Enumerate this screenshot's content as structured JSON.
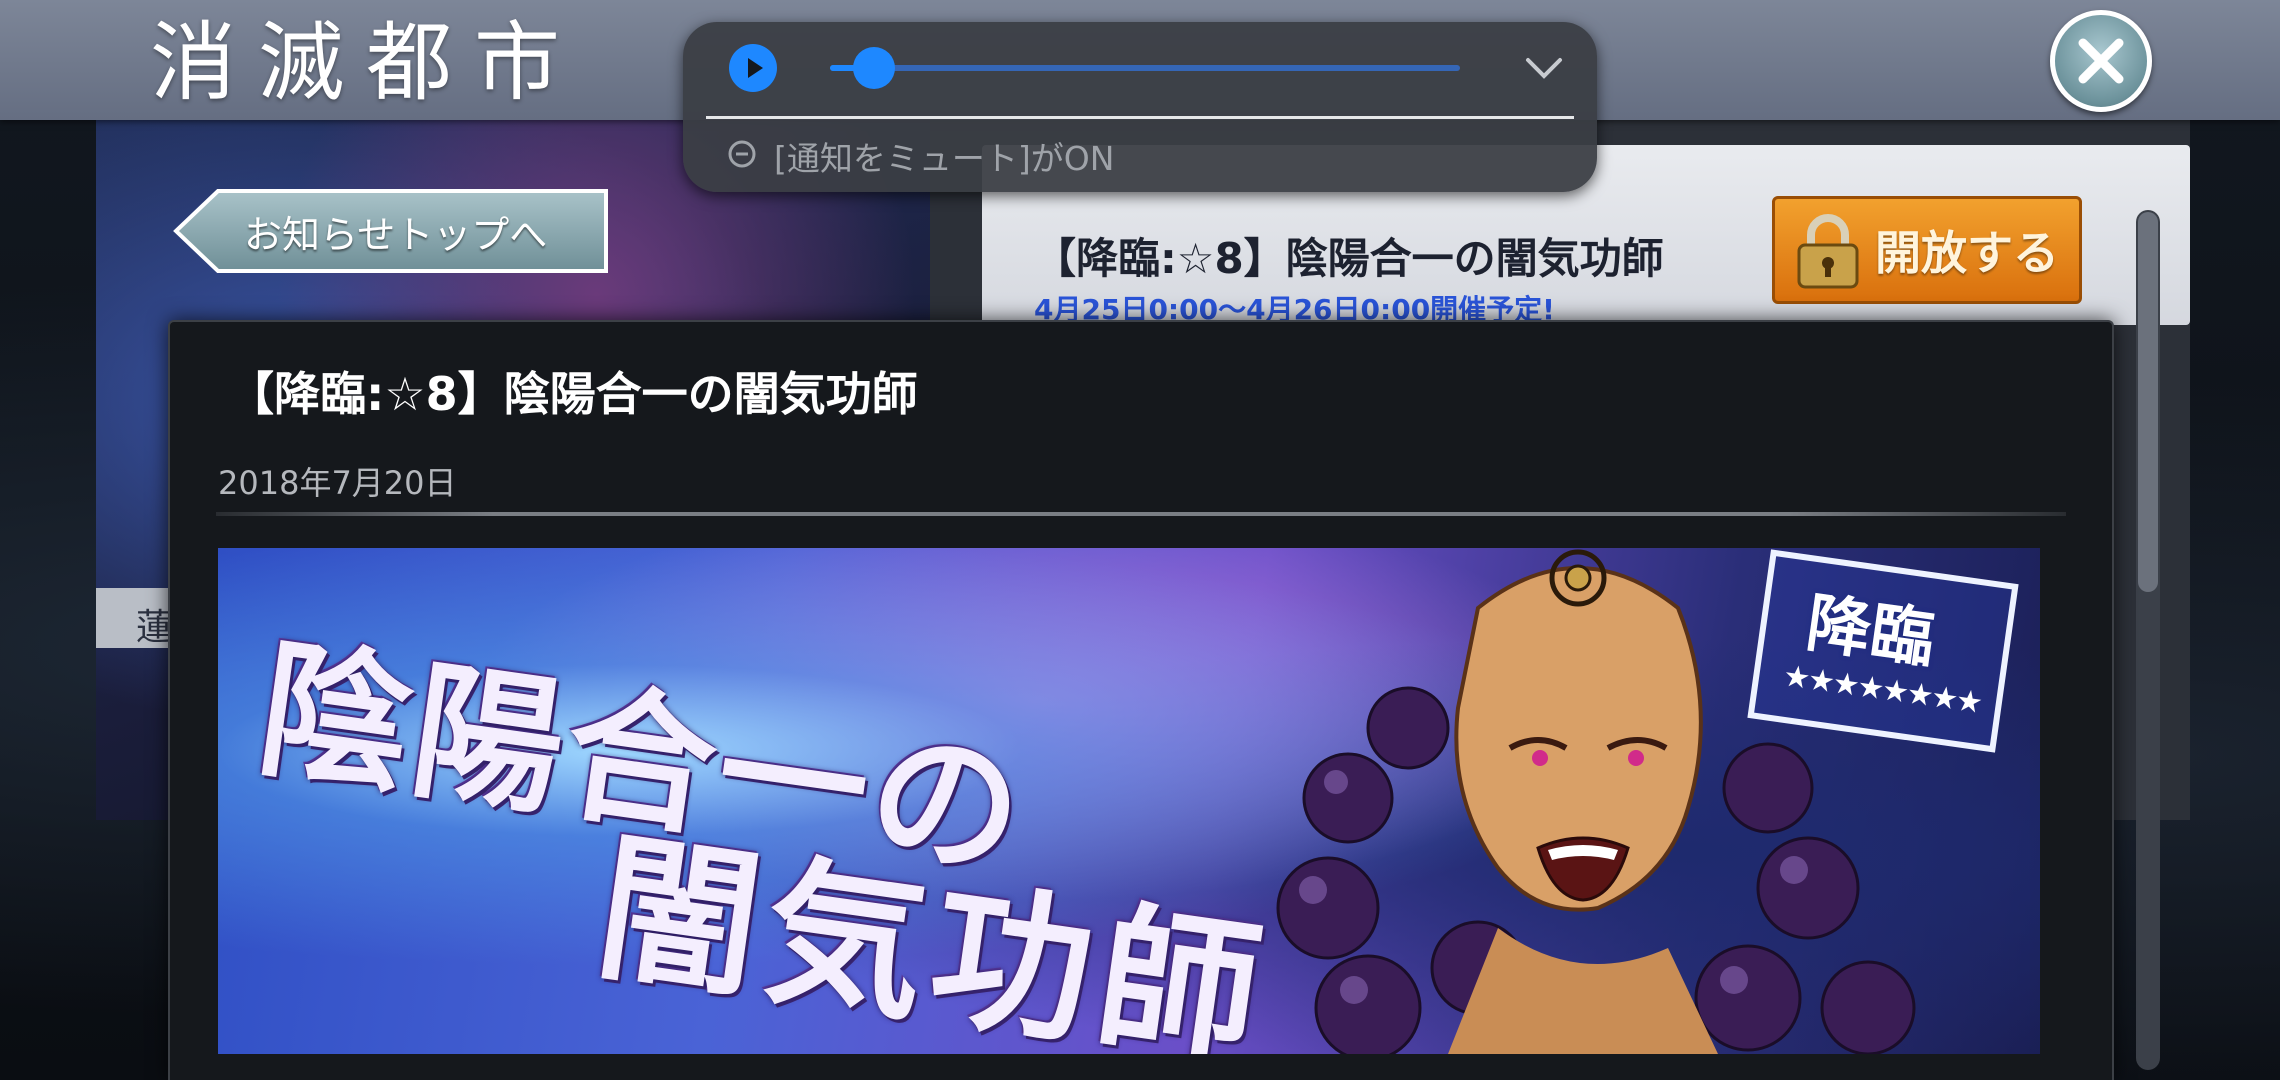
{
  "header": {
    "app_title": "消滅都市",
    "close_icon": "close-x-icon"
  },
  "navigation": {
    "back_label": "お知らせトップへ"
  },
  "background_card": {
    "title": "【降臨:☆8】陰陽合一の闇気功師",
    "schedule": "4月25日0:00〜4月26日0:00開催予定!",
    "unlock_label": "開放する",
    "lock_icon": "padlock-icon",
    "strip_label": "蓮"
  },
  "notice": {
    "title": "【降臨:☆8】陰陽合一の闇気功師",
    "date": "2018年7月20日",
    "banner": {
      "title_line1": "陰陽合一の",
      "title_line2": "闇気功師",
      "badge_text": "降臨",
      "badge_stars": "★★★★★★★★"
    }
  },
  "media_notification": {
    "play_icon": "play-icon",
    "progress": 0.07,
    "expand_icon": "chevron-down-icon",
    "status_icon": "minus-circle-icon",
    "status_text": "[通知をミュート]がON"
  },
  "colors": {
    "header_bg": "#737c8f",
    "accent_blue": "#1e88ff",
    "unlock_orange": "#e8861d",
    "schedule_blue": "#2a54d8"
  }
}
